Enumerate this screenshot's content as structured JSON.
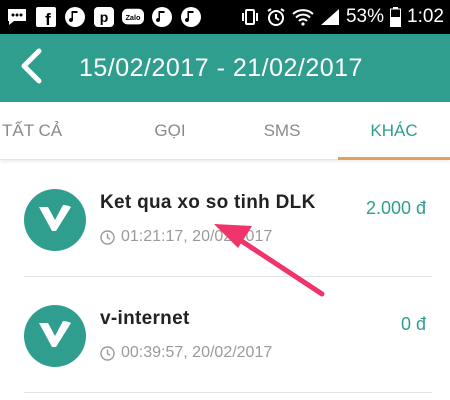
{
  "status_bar": {
    "notification_icons": [
      "chat-bubble-icon",
      "facebook-icon",
      "music-note-icon",
      "p-app-icon",
      "zalo-icon",
      "music-note-icon",
      "music-note-icon"
    ],
    "zalo_label": "Zalo",
    "facebook_label": "f",
    "p_label": "p",
    "battery": "53%",
    "time": "1:02"
  },
  "header": {
    "title": "15/02/2017 - 21/02/2017",
    "back_icon": "chevron-left-icon"
  },
  "tabs": [
    {
      "label": "TẤT CẢ",
      "active": false
    },
    {
      "label": "GỌI",
      "active": false
    },
    {
      "label": "SMS",
      "active": false
    },
    {
      "label": "KHÁC",
      "active": true
    }
  ],
  "items": [
    {
      "title": "Ket qua xo so tinh DLK",
      "time": "01:21:17, 20/02/2017",
      "amount": "2.000 đ"
    },
    {
      "title": "v-internet",
      "time": "00:39:57, 20/02/2017",
      "amount": "0 đ"
    }
  ],
  "colors": {
    "primary": "#2f9e8f",
    "tab_indicator": "#e0a15a",
    "annotation_arrow": "#f0336a"
  }
}
